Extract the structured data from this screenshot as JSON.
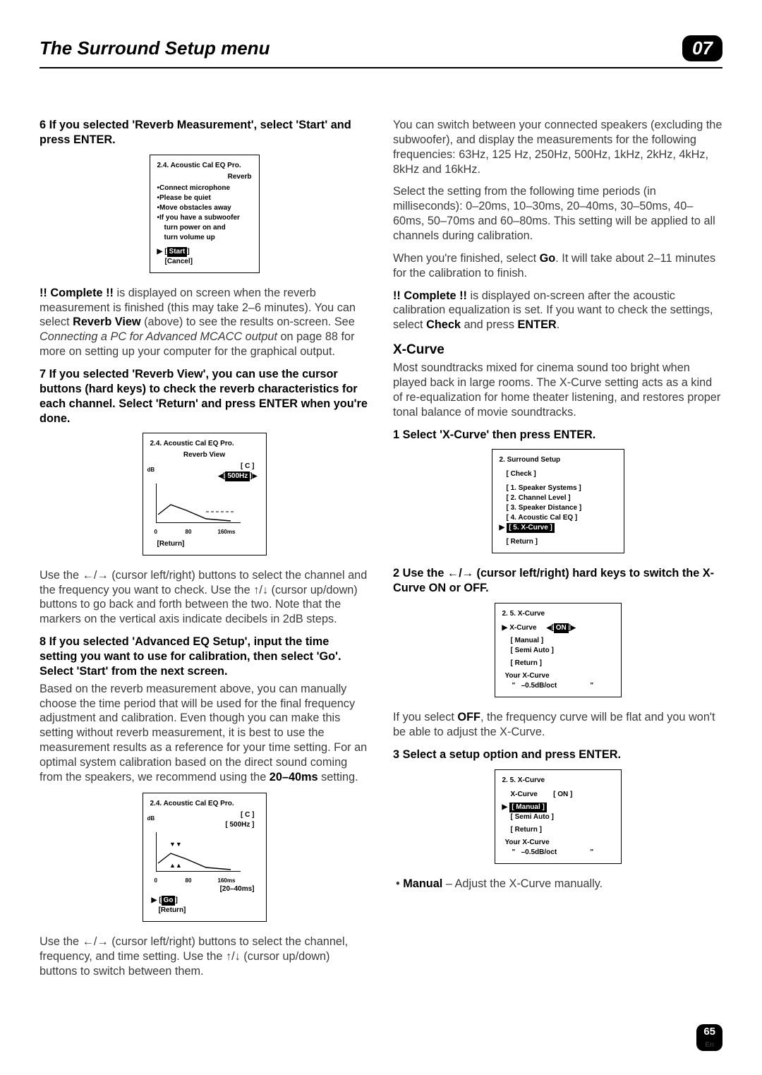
{
  "header": {
    "title": "The Surround Setup menu",
    "badge": "07"
  },
  "footer": {
    "page": "65",
    "lang": "En"
  },
  "left": {
    "step6": "6    If you selected 'Reverb Measurement', select 'Start' and press ENTER.",
    "osd1": {
      "title": "2.4. Acoustic Cal EQ Pro.",
      "sub": "Reverb",
      "l1": "•Connect microphone",
      "l2": "•Please be quiet",
      "l3": "•Move obstacles away",
      "l4": "•If you have a subwoofer",
      "l5": "turn power on and",
      "l6": "turn volume up",
      "start": "Start",
      "cancel": "[Cancel]"
    },
    "p1a": "!! Complete !!",
    "p1b": " is displayed on screen when the reverb measurement is finished (this may take 2–6 minutes). You can select ",
    "p1c": "Reverb View",
    "p1d": " (above) to see the results on-screen. See ",
    "p1e": "Connecting a PC for Advanced MCACC output",
    "p1f": " on page 88 for more on setting up your computer for the graphical output.",
    "step7": "7    If you selected 'Reverb View', you can use the cursor buttons (hard keys) to check the reverb characteristics for each channel. Select 'Return' and press ENTER when you're done.",
    "osd2": {
      "title": "2.4. Acoustic Cal EQ Pro.",
      "sub": "Reverb View",
      "ch": "[ C ]",
      "hz": "500Hz",
      "x1": "0",
      "x2": "80",
      "x3": "160ms",
      "yl": "dB",
      "ret": "[Return]"
    },
    "p2a": "Use the ",
    "p2b": " (cursor left/right) buttons to select the channel and the frequency you want to check. Use the ",
    "p2c": " (cursor up/down) buttons to go back and forth between the two. Note that the markers on the vertical axis indicate decibels in 2dB steps.",
    "step8": "8    If you selected 'Advanced EQ Setup', input the time setting you want to use for calibration, then select 'Go'. Select 'Start' from the next screen.",
    "p3a": "Based on the reverb measurement above, you can manually choose the time period that will be used for the final frequency adjustment and calibration. Even though you can make this setting without reverb measurement, it is best to use the measurement results as a reference for your time setting. For an optimal system calibration based on the direct sound coming from the speakers, we recommend using the ",
    "p3b": "20–40ms",
    "p3c": " setting.",
    "osd3": {
      "title": "2.4. Acoustic Cal EQ Pro.",
      "ch": "[ C ]",
      "hz": "[ 500Hz ]",
      "x1": "0",
      "x2": "80",
      "x3": "160ms",
      "ts": "[20–40ms]",
      "yl": "dB",
      "go": "Go",
      "ret": "[Return]"
    },
    "p4a": "Use the ",
    "p4b": " (cursor left/right) buttons to select the channel, frequency, and time setting. Use the ",
    "p4c": " (cursor up/down) buttons to switch between them."
  },
  "right": {
    "p1": "You can switch between your connected speakers (excluding the subwoofer), and display the measurements for the following frequencies: 63Hz, 125 Hz, 250Hz, 500Hz, 1kHz, 2kHz, 4kHz, 8kHz and 16kHz.",
    "p2": "Select the setting from the following time periods (in milliseconds): 0–20ms, 10–30ms, 20–40ms, 30–50ms, 40–60ms, 50–70ms and 60–80ms. This setting will be applied to all channels during calibration.",
    "p3a": "When you're finished, select ",
    "p3b": "Go",
    "p3c": ". It will take about 2–11 minutes for the calibration to finish.",
    "p4a": "!! Complete !!",
    "p4b": " is displayed on-screen after the acoustic calibration equalization is set. If you want to check the settings, select ",
    "p4c": "Check",
    "p4d": " and press ",
    "p4e": "ENTER",
    "p4f": ".",
    "h_xcurve": "X-Curve",
    "p5": "Most soundtracks mixed for cinema sound too bright when played back in large rooms. The X-Curve setting acts as a kind of re-equalization for home theater listening, and restores proper tonal balance of movie soundtracks.",
    "step1": "1    Select 'X-Curve' then press ENTER.",
    "osdR1": {
      "title": "2. Surround Setup",
      "check": "[ Check ]",
      "i1": "[ 1. Speaker Systems ]",
      "i2": "[ 2. Channel Level ]",
      "i3": "[ 3. Speaker Distance ]",
      "i4": "[ 4. Acoustic Cal EQ ]",
      "i5": "[ 5. X-Curve ]",
      "ret": "[ Return ]"
    },
    "step2a": "2    Use the ",
    "step2b": " (cursor left/right) hard keys to switch the X-Curve ON or OFF.",
    "osdR2": {
      "title": "2. 5. X-Curve",
      "row": "X-Curve",
      "on": "ON",
      "man": "[ Manual ]",
      "semi": "[ Semi Auto ]",
      "ret": "[ Return ]",
      "your": "Your X-Curve",
      "val": "–0.5dB/oct"
    },
    "p6a": "If you select ",
    "p6b": "OFF",
    "p6c": ", the frequency curve will be flat and you won't be able to adjust the X-Curve.",
    "step3": "3    Select a setup option and press ENTER.",
    "osdR3": {
      "title": "2. 5. X-Curve",
      "row": "X-Curve",
      "on": "[ ON ]",
      "man": "[ Manual ]",
      "semi": "[ Semi Auto ]",
      "ret": "[ Return ]",
      "your": "Your X-Curve",
      "val": "–0.5dB/oct"
    },
    "bullet1a": "Manual",
    "bullet1b": " – Adjust the X-Curve manually."
  },
  "glyphs": {
    "left": "←",
    "right": "→",
    "up": "↑",
    "down": "↓",
    "tri": "▶",
    "triL": "◀"
  }
}
